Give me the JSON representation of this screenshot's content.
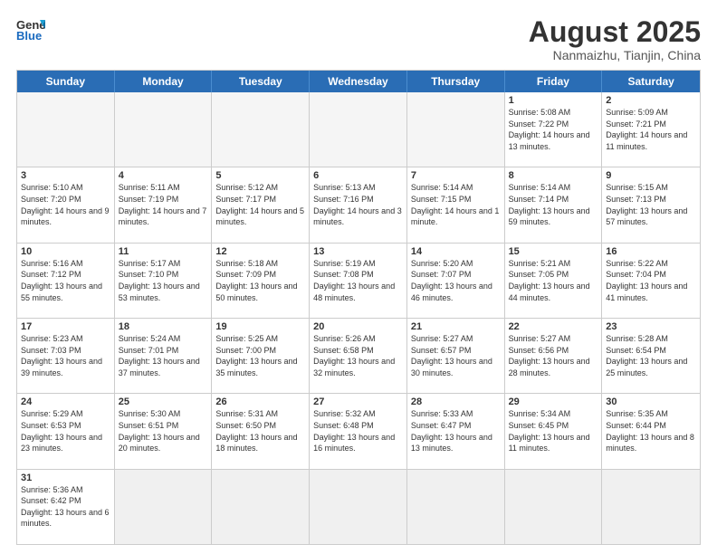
{
  "header": {
    "logo_general": "General",
    "logo_blue": "Blue",
    "month_title": "August 2025",
    "location": "Nanmaizhu, Tianjin, China"
  },
  "weekdays": [
    "Sunday",
    "Monday",
    "Tuesday",
    "Wednesday",
    "Thursday",
    "Friday",
    "Saturday"
  ],
  "rows": [
    [
      {
        "day": "",
        "info": ""
      },
      {
        "day": "",
        "info": ""
      },
      {
        "day": "",
        "info": ""
      },
      {
        "day": "",
        "info": ""
      },
      {
        "day": "",
        "info": ""
      },
      {
        "day": "1",
        "info": "Sunrise: 5:08 AM\nSunset: 7:22 PM\nDaylight: 14 hours and 13 minutes."
      },
      {
        "day": "2",
        "info": "Sunrise: 5:09 AM\nSunset: 7:21 PM\nDaylight: 14 hours and 11 minutes."
      }
    ],
    [
      {
        "day": "3",
        "info": "Sunrise: 5:10 AM\nSunset: 7:20 PM\nDaylight: 14 hours and 9 minutes."
      },
      {
        "day": "4",
        "info": "Sunrise: 5:11 AM\nSunset: 7:19 PM\nDaylight: 14 hours and 7 minutes."
      },
      {
        "day": "5",
        "info": "Sunrise: 5:12 AM\nSunset: 7:17 PM\nDaylight: 14 hours and 5 minutes."
      },
      {
        "day": "6",
        "info": "Sunrise: 5:13 AM\nSunset: 7:16 PM\nDaylight: 14 hours and 3 minutes."
      },
      {
        "day": "7",
        "info": "Sunrise: 5:14 AM\nSunset: 7:15 PM\nDaylight: 14 hours and 1 minute."
      },
      {
        "day": "8",
        "info": "Sunrise: 5:14 AM\nSunset: 7:14 PM\nDaylight: 13 hours and 59 minutes."
      },
      {
        "day": "9",
        "info": "Sunrise: 5:15 AM\nSunset: 7:13 PM\nDaylight: 13 hours and 57 minutes."
      }
    ],
    [
      {
        "day": "10",
        "info": "Sunrise: 5:16 AM\nSunset: 7:12 PM\nDaylight: 13 hours and 55 minutes."
      },
      {
        "day": "11",
        "info": "Sunrise: 5:17 AM\nSunset: 7:10 PM\nDaylight: 13 hours and 53 minutes."
      },
      {
        "day": "12",
        "info": "Sunrise: 5:18 AM\nSunset: 7:09 PM\nDaylight: 13 hours and 50 minutes."
      },
      {
        "day": "13",
        "info": "Sunrise: 5:19 AM\nSunset: 7:08 PM\nDaylight: 13 hours and 48 minutes."
      },
      {
        "day": "14",
        "info": "Sunrise: 5:20 AM\nSunset: 7:07 PM\nDaylight: 13 hours and 46 minutes."
      },
      {
        "day": "15",
        "info": "Sunrise: 5:21 AM\nSunset: 7:05 PM\nDaylight: 13 hours and 44 minutes."
      },
      {
        "day": "16",
        "info": "Sunrise: 5:22 AM\nSunset: 7:04 PM\nDaylight: 13 hours and 41 minutes."
      }
    ],
    [
      {
        "day": "17",
        "info": "Sunrise: 5:23 AM\nSunset: 7:03 PM\nDaylight: 13 hours and 39 minutes."
      },
      {
        "day": "18",
        "info": "Sunrise: 5:24 AM\nSunset: 7:01 PM\nDaylight: 13 hours and 37 minutes."
      },
      {
        "day": "19",
        "info": "Sunrise: 5:25 AM\nSunset: 7:00 PM\nDaylight: 13 hours and 35 minutes."
      },
      {
        "day": "20",
        "info": "Sunrise: 5:26 AM\nSunset: 6:58 PM\nDaylight: 13 hours and 32 minutes."
      },
      {
        "day": "21",
        "info": "Sunrise: 5:27 AM\nSunset: 6:57 PM\nDaylight: 13 hours and 30 minutes."
      },
      {
        "day": "22",
        "info": "Sunrise: 5:27 AM\nSunset: 6:56 PM\nDaylight: 13 hours and 28 minutes."
      },
      {
        "day": "23",
        "info": "Sunrise: 5:28 AM\nSunset: 6:54 PM\nDaylight: 13 hours and 25 minutes."
      }
    ],
    [
      {
        "day": "24",
        "info": "Sunrise: 5:29 AM\nSunset: 6:53 PM\nDaylight: 13 hours and 23 minutes."
      },
      {
        "day": "25",
        "info": "Sunrise: 5:30 AM\nSunset: 6:51 PM\nDaylight: 13 hours and 20 minutes."
      },
      {
        "day": "26",
        "info": "Sunrise: 5:31 AM\nSunset: 6:50 PM\nDaylight: 13 hours and 18 minutes."
      },
      {
        "day": "27",
        "info": "Sunrise: 5:32 AM\nSunset: 6:48 PM\nDaylight: 13 hours and 16 minutes."
      },
      {
        "day": "28",
        "info": "Sunrise: 5:33 AM\nSunset: 6:47 PM\nDaylight: 13 hours and 13 minutes."
      },
      {
        "day": "29",
        "info": "Sunrise: 5:34 AM\nSunset: 6:45 PM\nDaylight: 13 hours and 11 minutes."
      },
      {
        "day": "30",
        "info": "Sunrise: 5:35 AM\nSunset: 6:44 PM\nDaylight: 13 hours and 8 minutes."
      }
    ],
    [
      {
        "day": "31",
        "info": "Sunrise: 5:36 AM\nSunset: 6:42 PM\nDaylight: 13 hours and 6 minutes."
      },
      {
        "day": "",
        "info": ""
      },
      {
        "day": "",
        "info": ""
      },
      {
        "day": "",
        "info": ""
      },
      {
        "day": "",
        "info": ""
      },
      {
        "day": "",
        "info": ""
      },
      {
        "day": "",
        "info": ""
      }
    ]
  ]
}
